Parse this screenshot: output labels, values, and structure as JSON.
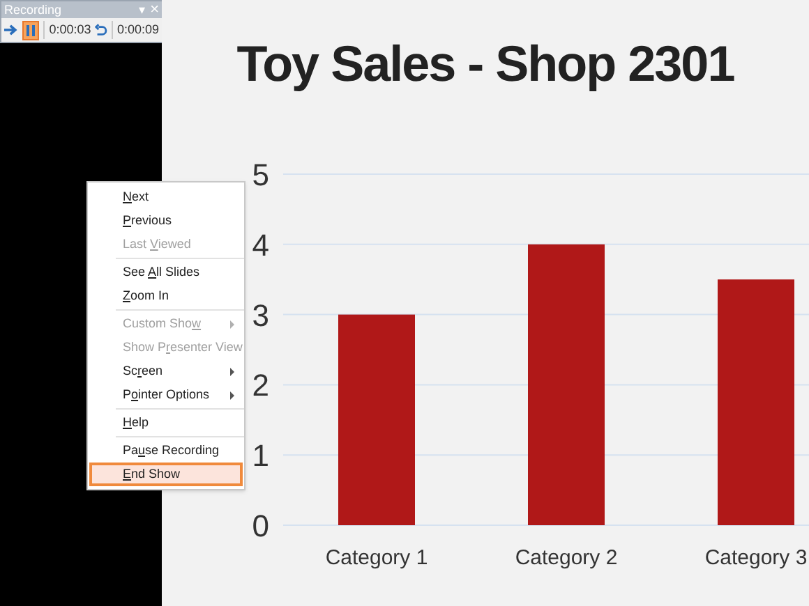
{
  "recording_toolbar": {
    "title": "Recording",
    "dropdown": "▾",
    "close": "×",
    "pause": {
      "on": true
    },
    "slide_time": "0:00:03",
    "total_time": "0:00:09"
  },
  "slide": {
    "title": "Toy Sales - Shop 2301",
    "chart_data": {
      "type": "bar",
      "categories": [
        "Category 1",
        "Category 2",
        "Category 3"
      ],
      "series": [
        {
          "color": "#b01818",
          "values": [
            3,
            4,
            3.5
          ]
        }
      ],
      "ylim": [
        0,
        5
      ],
      "yticks": [
        0,
        1,
        2,
        3,
        4,
        5
      ],
      "grid": true
    }
  },
  "context_menu": {
    "items": [
      {
        "kind": "item",
        "label": {
          "key": "N",
          "after": "ext"
        },
        "disabled": false,
        "submenu": false,
        "selected": false
      },
      {
        "kind": "item",
        "label": {
          "key": "P",
          "after": "revious"
        },
        "disabled": false,
        "submenu": false,
        "selected": false
      },
      {
        "kind": "item",
        "label": {
          "before": "Last ",
          "key": "V",
          "after": "iewed"
        },
        "disabled": true,
        "submenu": false,
        "selected": false
      },
      {
        "kind": "separator"
      },
      {
        "kind": "item",
        "label": {
          "before": "See ",
          "key": "A",
          "after": "ll Slides"
        },
        "disabled": false,
        "submenu": false,
        "selected": false
      },
      {
        "kind": "item",
        "label": {
          "key": "Z",
          "after": "oom In"
        },
        "disabled": false,
        "submenu": false,
        "selected": false
      },
      {
        "kind": "separator"
      },
      {
        "kind": "item",
        "label": {
          "before": "Custom Sho",
          "key": "w"
        },
        "disabled": true,
        "submenu": true,
        "selected": false
      },
      {
        "kind": "item",
        "label": {
          "before": "Show P",
          "key": "r",
          "after": "esenter View"
        },
        "disabled": true,
        "submenu": false,
        "selected": false
      },
      {
        "kind": "item",
        "label": {
          "before": "Sc",
          "key": "r",
          "after": "een"
        },
        "disabled": false,
        "submenu": true,
        "selected": false
      },
      {
        "kind": "item",
        "label": {
          "before": "P",
          "key": "o",
          "after": "inter Options"
        },
        "disabled": false,
        "submenu": true,
        "selected": false
      },
      {
        "kind": "separator"
      },
      {
        "kind": "item",
        "label": {
          "key": "H",
          "after": "elp"
        },
        "disabled": false,
        "submenu": false,
        "selected": false
      },
      {
        "kind": "separator"
      },
      {
        "kind": "item",
        "label": {
          "before": "Pa",
          "key": "u",
          "after": "se Recording"
        },
        "disabled": false,
        "submenu": false,
        "selected": false
      },
      {
        "kind": "item",
        "label": {
          "key": "E",
          "after": "nd Show"
        },
        "disabled": false,
        "submenu": false,
        "selected": true
      }
    ]
  }
}
